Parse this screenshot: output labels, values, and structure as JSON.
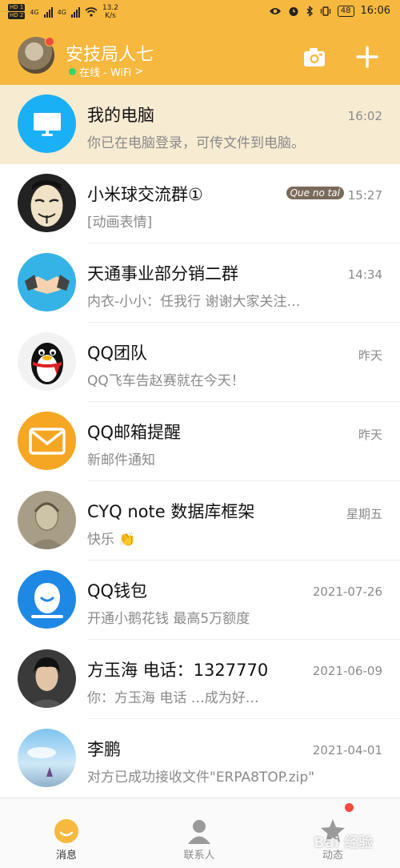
{
  "status_bar": {
    "hd_labels": [
      "HD 1",
      "HD 2"
    ],
    "signal": [
      "4G",
      "4G"
    ],
    "net_speed_value": "13.2",
    "net_speed_unit": "K/s",
    "battery": "48",
    "time": "16:06"
  },
  "header": {
    "profile_name": "安技局人七",
    "status_text": "在线 - WiFi",
    "status_arrow": ">",
    "camera_icon": "camera-icon",
    "plus_icon": "plus-icon"
  },
  "chats": [
    {
      "title": "我的电脑",
      "preview": "你已在电脑登录，可传文件到电脑。",
      "time": "16:02",
      "avatar": "computer-icon",
      "color": "#1ab0f5"
    },
    {
      "title": "小米球交流群①",
      "preview": "[动画表情]",
      "time": "15:27",
      "avatar": "mask-avatar",
      "sticker": "Que no tal"
    },
    {
      "title": "天通事业部分销二群",
      "preview": "内衣-小小：任我行 谢谢大家关注…",
      "time": "14:34",
      "avatar": "handshake-avatar"
    },
    {
      "title": "QQ团队",
      "preview": "QQ飞车告赵赛就在今天！",
      "time": "昨天",
      "avatar": "penguin-avatar"
    },
    {
      "title": "QQ邮箱提醒",
      "preview": "新邮件通知",
      "time": "昨天",
      "avatar": "mail-icon",
      "color": "#f5a623"
    },
    {
      "title": "CYQ note 数据库框架",
      "preview": "快乐 👏",
      "time": "星期五",
      "avatar": "portrait-avatar"
    },
    {
      "title": "QQ钱包",
      "preview": "开通小鹅花钱 最高5万额度",
      "time": "2021-07-26",
      "avatar": "wallet-icon",
      "color": "#1e88e5"
    },
    {
      "title": "方玉海 电话：1327770",
      "preview": "你：方玉海 电话 …成为好…",
      "time": "2021-06-09",
      "avatar": "person-avatar"
    },
    {
      "title": "李鹏",
      "preview": "对方已成功接收文件\"ERPA8TOP.zip\"",
      "time": "2021-04-01",
      "avatar": "sky-avatar"
    }
  ],
  "bottom_nav": [
    {
      "label": "消息",
      "icon": "message-icon",
      "active": true
    },
    {
      "label": "联系人",
      "icon": "contacts-icon",
      "active": false
    },
    {
      "label": "动态",
      "icon": "star-icon",
      "active": false,
      "dot": true
    }
  ],
  "watermark": "Bai 经验",
  "colors": {
    "accent": "#f6b83e",
    "pinned_bg": "#f7ebd2",
    "badge_red": "#f24b3c"
  }
}
